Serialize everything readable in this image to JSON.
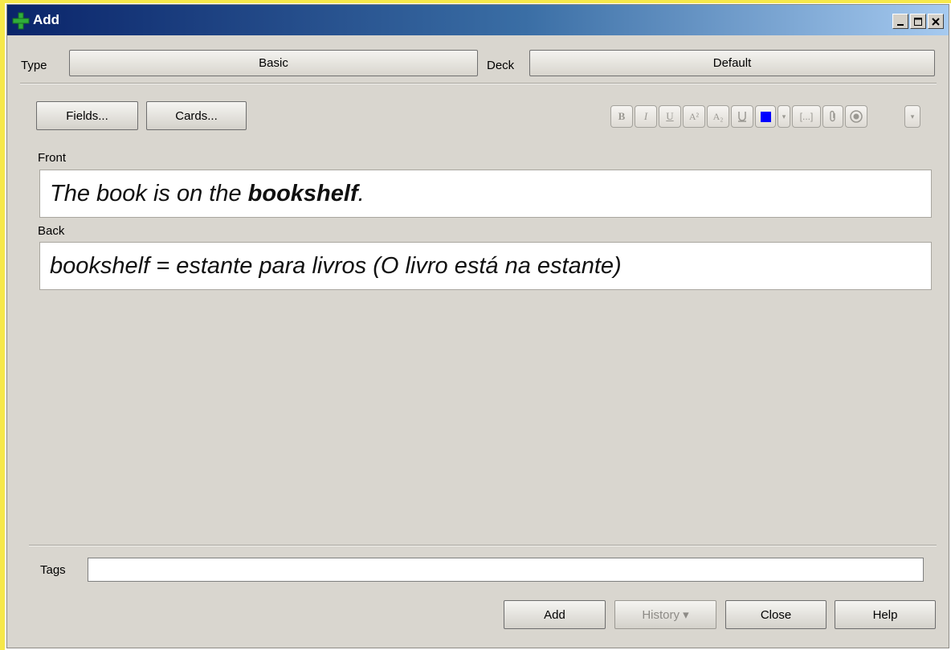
{
  "window": {
    "title": "Add"
  },
  "type_row": {
    "type_label": "Type",
    "type_value": "Basic",
    "deck_label": "Deck",
    "deck_value": "Default"
  },
  "toolbar": {
    "fields_label": "Fields...",
    "cards_label": "Cards...",
    "bracket_label": "[...]",
    "color": "#0000ff"
  },
  "fields": [
    {
      "label": "Front",
      "prefix": "The book is on the ",
      "bold": "bookshelf",
      "suffix": "."
    },
    {
      "label": "Back",
      "text": "bookshelf = estante para livros (O livro está na estante)"
    }
  ],
  "tags": {
    "label": "Tags",
    "value": ""
  },
  "buttons": {
    "add": "Add",
    "history": "History ▾",
    "close": "Close",
    "help": "Help"
  }
}
